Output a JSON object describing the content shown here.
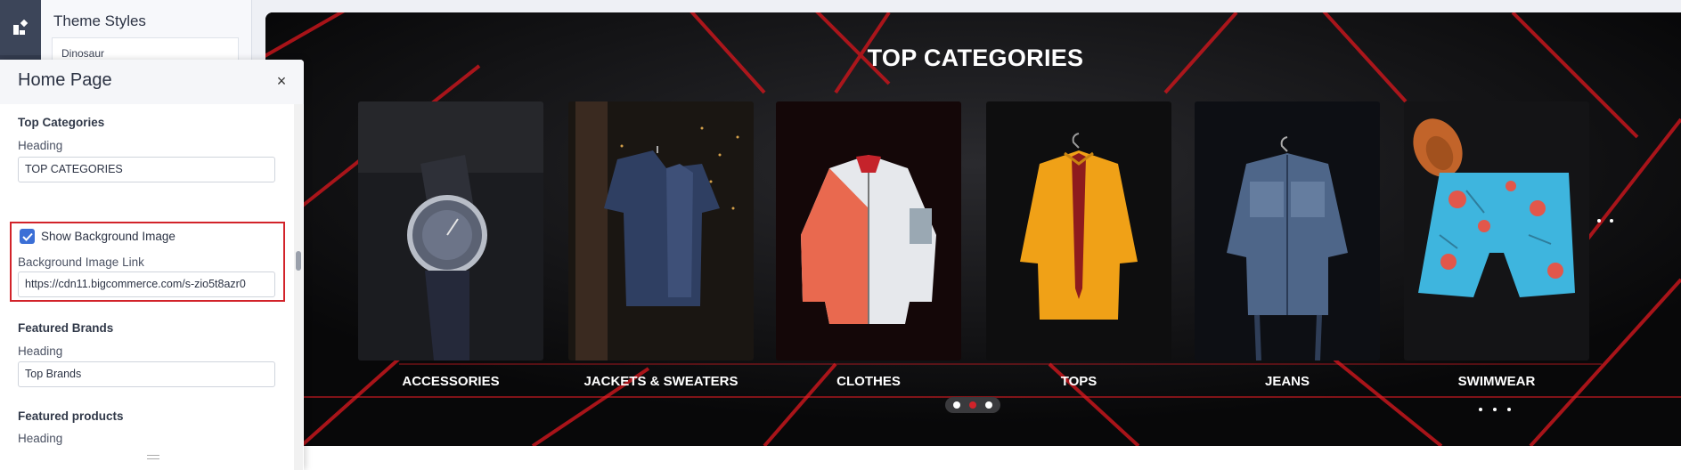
{
  "theme_panel": {
    "title": "Theme Styles",
    "card_label": "Dinosaur"
  },
  "home_panel": {
    "title": "Home Page",
    "close_glyph": "×",
    "top_categories": {
      "section_title": "Top Categories",
      "heading_label": "Heading",
      "heading_value": "TOP CATEGORIES",
      "show_bg_label": "Show Background Image",
      "show_bg_checked": true,
      "bg_link_label": "Background Image Link",
      "bg_link_value": "https://cdn11.bigcommerce.com/s-zio5t8azr0"
    },
    "featured_brands": {
      "section_title": "Featured Brands",
      "heading_label": "Heading",
      "heading_value": "Top Brands"
    },
    "featured_products": {
      "section_title": "Featured products",
      "heading_label": "Heading"
    }
  },
  "preview": {
    "heading": "TOP CATEGORIES",
    "categories": [
      {
        "label": "ACCESSORIES",
        "icon": "watch-image"
      },
      {
        "label": "JACKETS & SWEATERS",
        "icon": "jacket-image"
      },
      {
        "label": "CLOTHES",
        "icon": "bomber-jacket-image"
      },
      {
        "label": "TOPS",
        "icon": "shirt-image"
      },
      {
        "label": "JEANS",
        "icon": "denim-jacket-image"
      },
      {
        "label": "SWIMWEAR",
        "icon": "swim-shorts-image"
      }
    ],
    "pager": {
      "count": 3,
      "active_index": 1
    }
  },
  "colors": {
    "accent_red": "#d2232a",
    "checkbox_blue": "#3b6fd6",
    "rail": "#323a4d"
  }
}
